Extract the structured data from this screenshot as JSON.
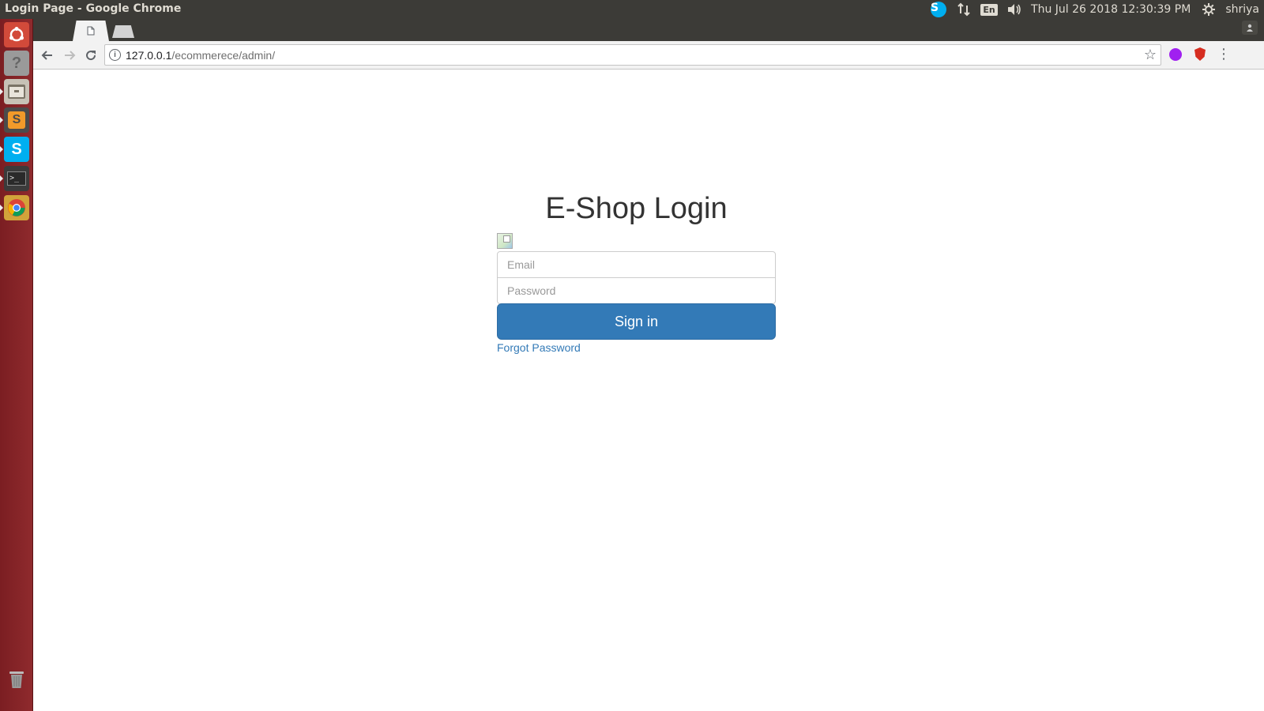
{
  "window": {
    "title": "Login Page - Google Chrome"
  },
  "panel": {
    "datetime": "Thu Jul 26 2018 12:30:39 PM",
    "user": "shriya",
    "keyboard": "En",
    "skype_glyph": "S"
  },
  "launcher": {
    "items": [
      {
        "name": "ubuntu-dash-icon"
      },
      {
        "name": "help-icon"
      },
      {
        "name": "files-icon"
      },
      {
        "name": "sublime-text-icon"
      },
      {
        "name": "skype-icon"
      },
      {
        "name": "terminal-icon"
      },
      {
        "name": "chrome-icon"
      },
      {
        "name": "trash-icon"
      }
    ]
  },
  "browser": {
    "url_host": "127.0.0.1",
    "url_path": "/ecommerece/admin/"
  },
  "login": {
    "title": "E-Shop Login",
    "email_placeholder": "Email",
    "password_placeholder": "Password",
    "signin_label": "Sign in",
    "forgot_label": "Forgot Password"
  },
  "colors": {
    "primary": "#337ab7",
    "panel_bg": "#3c3b37",
    "launcher_bg": "#8f2a2d"
  }
}
